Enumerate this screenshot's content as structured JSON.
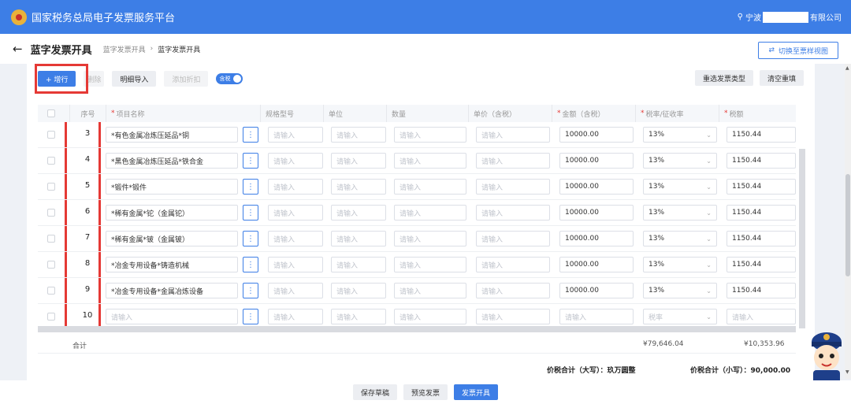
{
  "header": {
    "app_title": "国家税务总局电子发票服务平台",
    "user_prefix": "宁波",
    "user_suffix": "有限公司",
    "colors": {
      "primary": "#3d7ee6",
      "highlight": "#e53935"
    }
  },
  "page": {
    "title": "蓝字发票开具",
    "breadcrumb": [
      "蓝字发票开具",
      "蓝字发票开具"
    ],
    "switch_view": "切换至票样视图"
  },
  "toolbar": {
    "add_row": "+ 增行",
    "delete": "删除",
    "import_detail": "明细导入",
    "add_discount": "添加折扣",
    "tax_toggle": "含税",
    "reselect_type": "重选发票类型",
    "clear_refill": "清空重填"
  },
  "table": {
    "headers": {
      "seq": "序号",
      "item_name": "项目名称",
      "spec": "规格型号",
      "unit": "单位",
      "quantity": "数量",
      "unit_price": "单价（含税）",
      "amount": "金额（含税）",
      "tax_rate": "税率/征收率",
      "tax": "税额"
    },
    "placeholder": "请输入",
    "rate_placeholder": "税率",
    "rows": [
      {
        "seq": "3",
        "name": "*有色金属冶炼压延品*铜",
        "amount": "10000.00",
        "rate": "13%",
        "tax": "1150.44"
      },
      {
        "seq": "4",
        "name": "*黑色金属冶炼压延品*铁合金",
        "amount": "10000.00",
        "rate": "13%",
        "tax": "1150.44"
      },
      {
        "seq": "5",
        "name": "*锻件*锻件",
        "amount": "10000.00",
        "rate": "13%",
        "tax": "1150.44"
      },
      {
        "seq": "6",
        "name": "*稀有金属*铊（金属铊）",
        "amount": "10000.00",
        "rate": "13%",
        "tax": "1150.44"
      },
      {
        "seq": "7",
        "name": "*稀有金属*铍（金属铍）",
        "amount": "10000.00",
        "rate": "13%",
        "tax": "1150.44"
      },
      {
        "seq": "8",
        "name": "*冶金专用设备*铸造机械",
        "amount": "10000.00",
        "rate": "13%",
        "tax": "1150.44"
      },
      {
        "seq": "9",
        "name": "*冶金专用设备*金属冶炼设备",
        "amount": "10000.00",
        "rate": "13%",
        "tax": "1150.44"
      },
      {
        "seq": "10",
        "name": "",
        "amount": "",
        "rate": "",
        "tax": ""
      }
    ]
  },
  "totals": {
    "label": "合计",
    "amount": "¥79,646.04",
    "tax": "¥10,353.96",
    "upper_label": "价税合计（大写）：",
    "upper_value": "玖万圆整",
    "lower_label": "价税合计（小写）：",
    "lower_value": "90,000.00"
  },
  "footer": {
    "save_draft": "保存草稿",
    "preview": "预览发票",
    "issue": "发票开具"
  }
}
